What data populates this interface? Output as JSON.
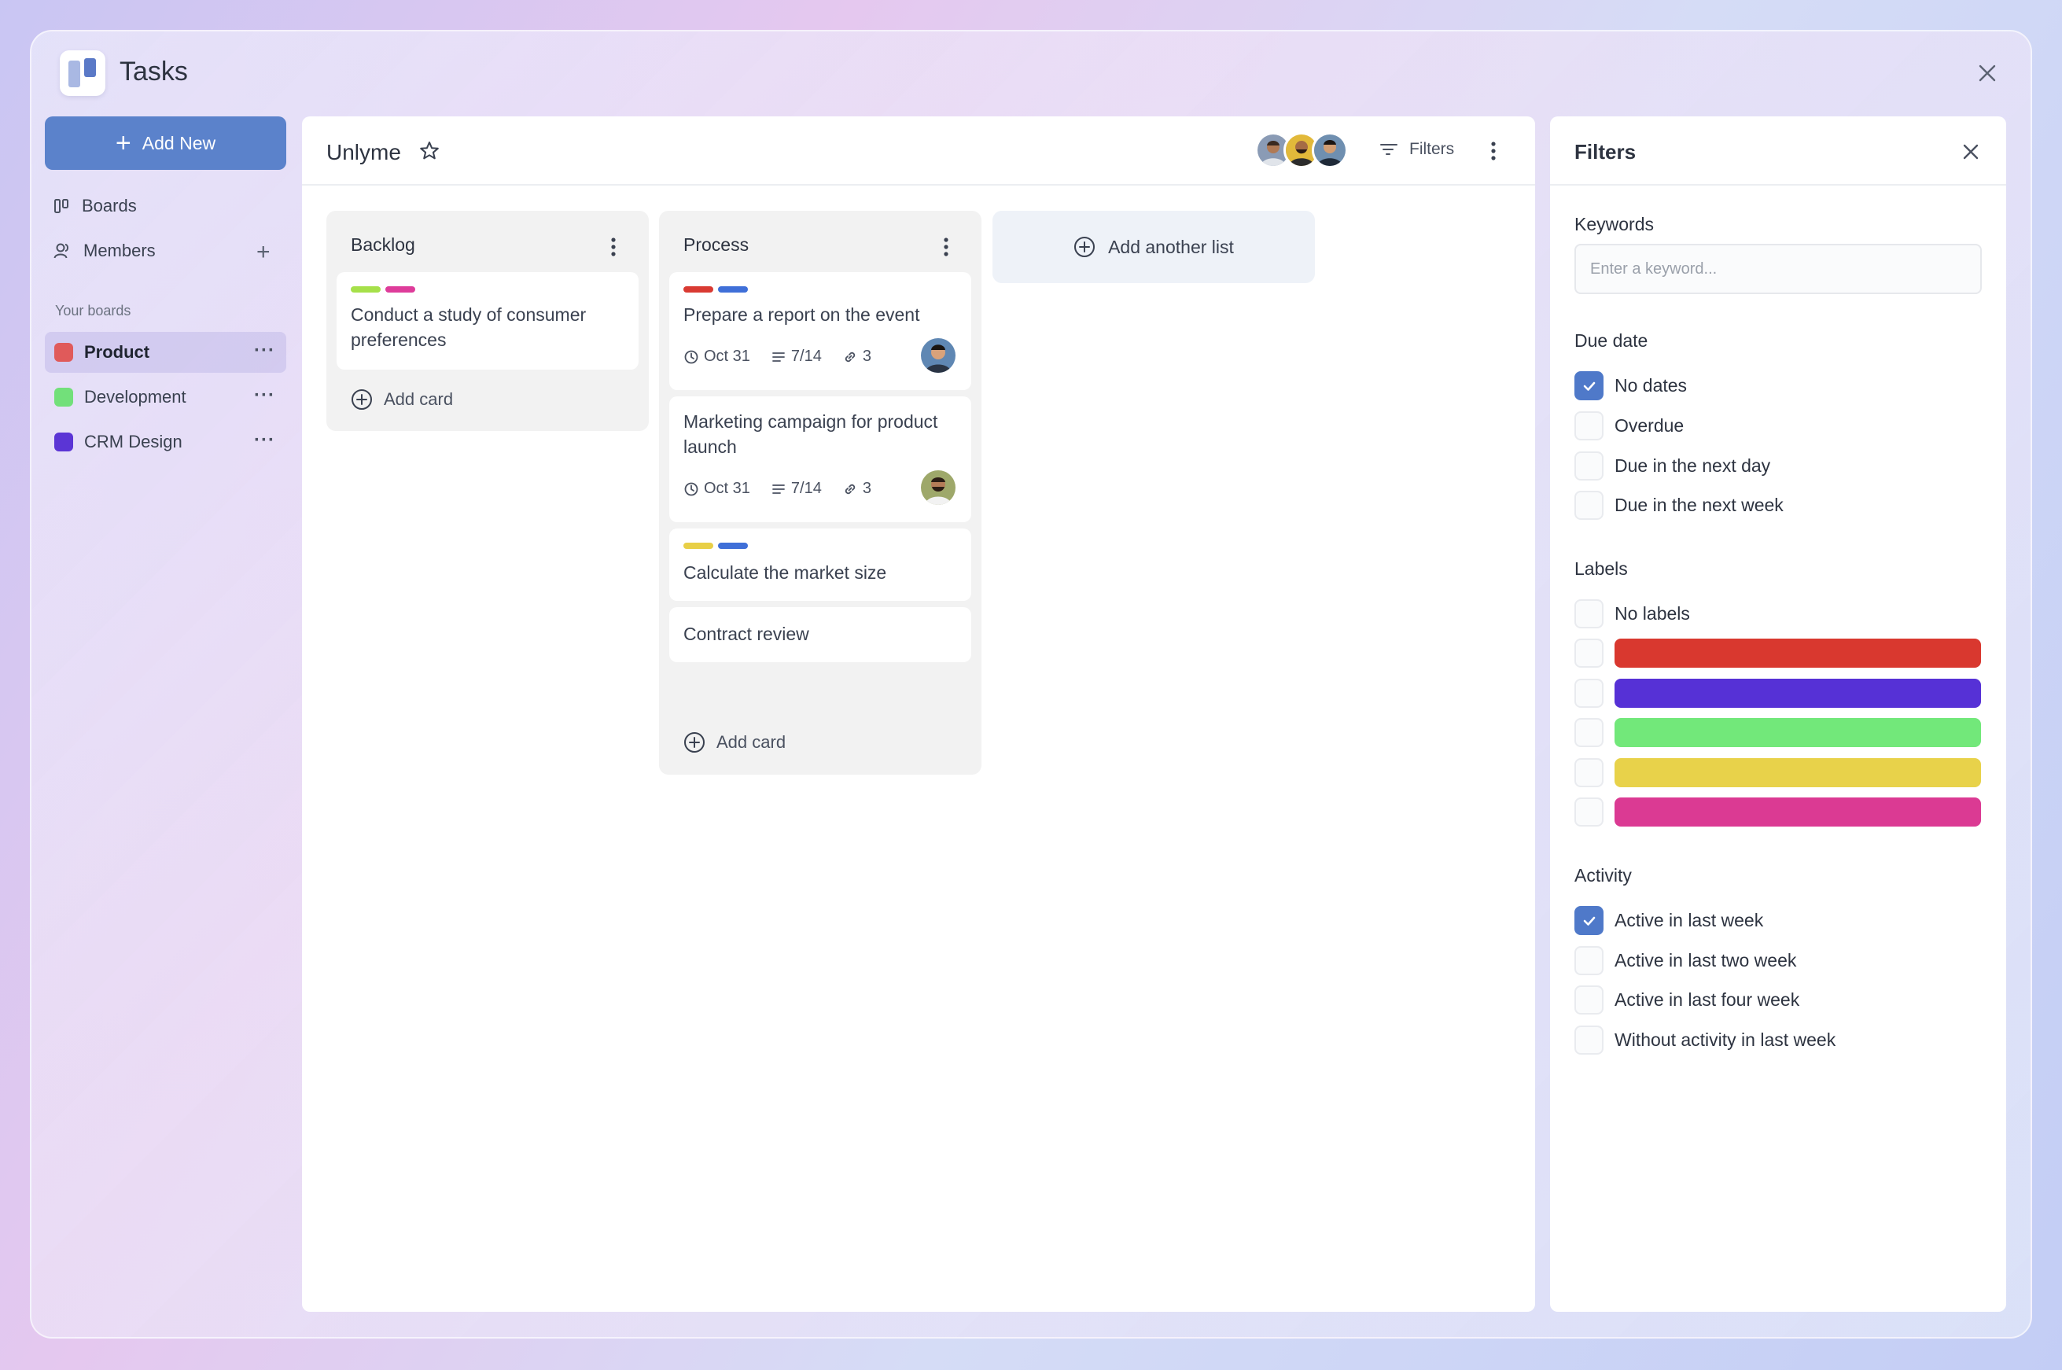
{
  "app": {
    "title": "Tasks"
  },
  "sidebar": {
    "add_new_label": "Add New",
    "nav": [
      {
        "label": "Boards",
        "icon": "boards-icon"
      },
      {
        "label": "Members",
        "icon": "members-icon"
      }
    ],
    "section_label": "Your boards",
    "boards": [
      {
        "name": "Product",
        "color": "#e05a5a",
        "active": true
      },
      {
        "name": "Development",
        "color": "#72e07a",
        "active": false
      },
      {
        "name": "CRM Design",
        "color": "#5b35d5",
        "active": false
      }
    ]
  },
  "board": {
    "title": "Unlyme",
    "filters_label": "Filters",
    "columns": [
      {
        "title": "Backlog",
        "cards": [
          {
            "labels": [
              "#a6e04a",
              "#de3c9a"
            ],
            "text": "Conduct a study of consumer preferences"
          }
        ],
        "add_card_label": "Add card"
      },
      {
        "title": "Process",
        "cards": [
          {
            "labels": [
              "#d93a32",
              "#3f6fd8"
            ],
            "text": "Prepare a report on the event",
            "date": "Oct 31",
            "checklist": "7/14",
            "attachments": "3"
          },
          {
            "labels": [],
            "text": "Marketing campaign for product launch",
            "date": "Oct 31",
            "checklist": "7/14",
            "attachments": "3"
          },
          {
            "labels": [
              "#e8cf47",
              "#3f6fd8"
            ],
            "text": "Calculate the market size"
          },
          {
            "labels": [],
            "text": "Contract review"
          }
        ],
        "add_card_label": "Add card"
      }
    ],
    "add_list_label": "Add another list"
  },
  "filters": {
    "title": "Filters",
    "keywords_label": "Keywords",
    "keywords_placeholder": "Enter a keyword...",
    "due_date_label": "Due date",
    "due_date_options": [
      {
        "label": "No dates",
        "checked": true
      },
      {
        "label": "Overdue",
        "checked": false
      },
      {
        "label": "Due in the next day",
        "checked": false
      },
      {
        "label": "Due in the next week",
        "checked": false
      }
    ],
    "labels_label": "Labels",
    "no_labels": "No labels",
    "label_colors": [
      "#d9382f",
      "#5631d6",
      "#72e87a",
      "#e8d24a",
      "#db3a93"
    ],
    "activity_label": "Activity",
    "activity_options": [
      {
        "label": "Active in last week",
        "checked": true
      },
      {
        "label": "Active in last two week",
        "checked": false
      },
      {
        "label": "Active in last four week",
        "checked": false
      },
      {
        "label": "Without activity in last week",
        "checked": false
      }
    ]
  }
}
